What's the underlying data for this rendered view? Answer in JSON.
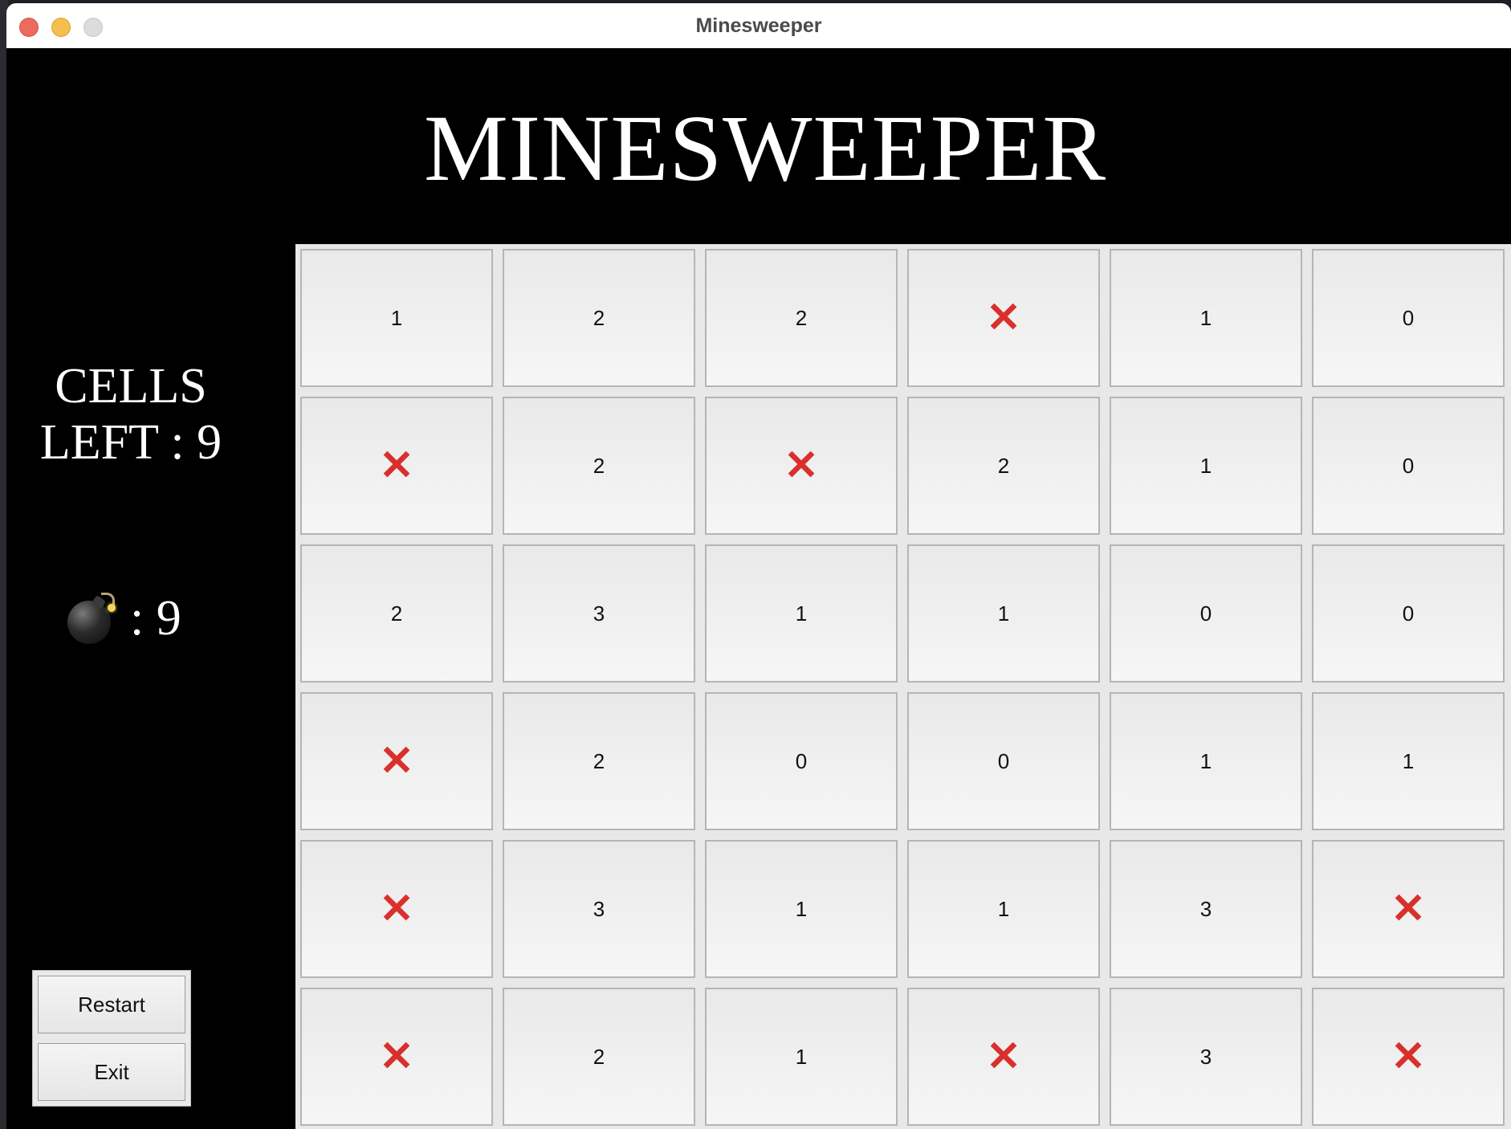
{
  "window": {
    "title": "Minesweeper"
  },
  "game": {
    "heading": "MINESWEEPER",
    "cells_left_line1": "CELLS",
    "cells_left_line2": "LEFT : 9",
    "mines_label": ": 9"
  },
  "buttons": {
    "restart": "Restart",
    "exit": "Exit"
  },
  "mine_symbol": "✕",
  "colors": {
    "mine": "#d9302c",
    "background": "#000000"
  },
  "icons": {
    "mine_counter": "bomb-icon",
    "mine_cell": "red-x-icon"
  },
  "board": [
    [
      "1",
      "2",
      "2",
      "X",
      "1",
      "0"
    ],
    [
      "X",
      "2",
      "X",
      "2",
      "1",
      "0"
    ],
    [
      "2",
      "3",
      "1",
      "1",
      "0",
      "0"
    ],
    [
      "X",
      "2",
      "0",
      "0",
      "1",
      "1"
    ],
    [
      "X",
      "3",
      "1",
      "1",
      "3",
      "X"
    ],
    [
      "X",
      "2",
      "1",
      "X",
      "3",
      "X"
    ]
  ]
}
